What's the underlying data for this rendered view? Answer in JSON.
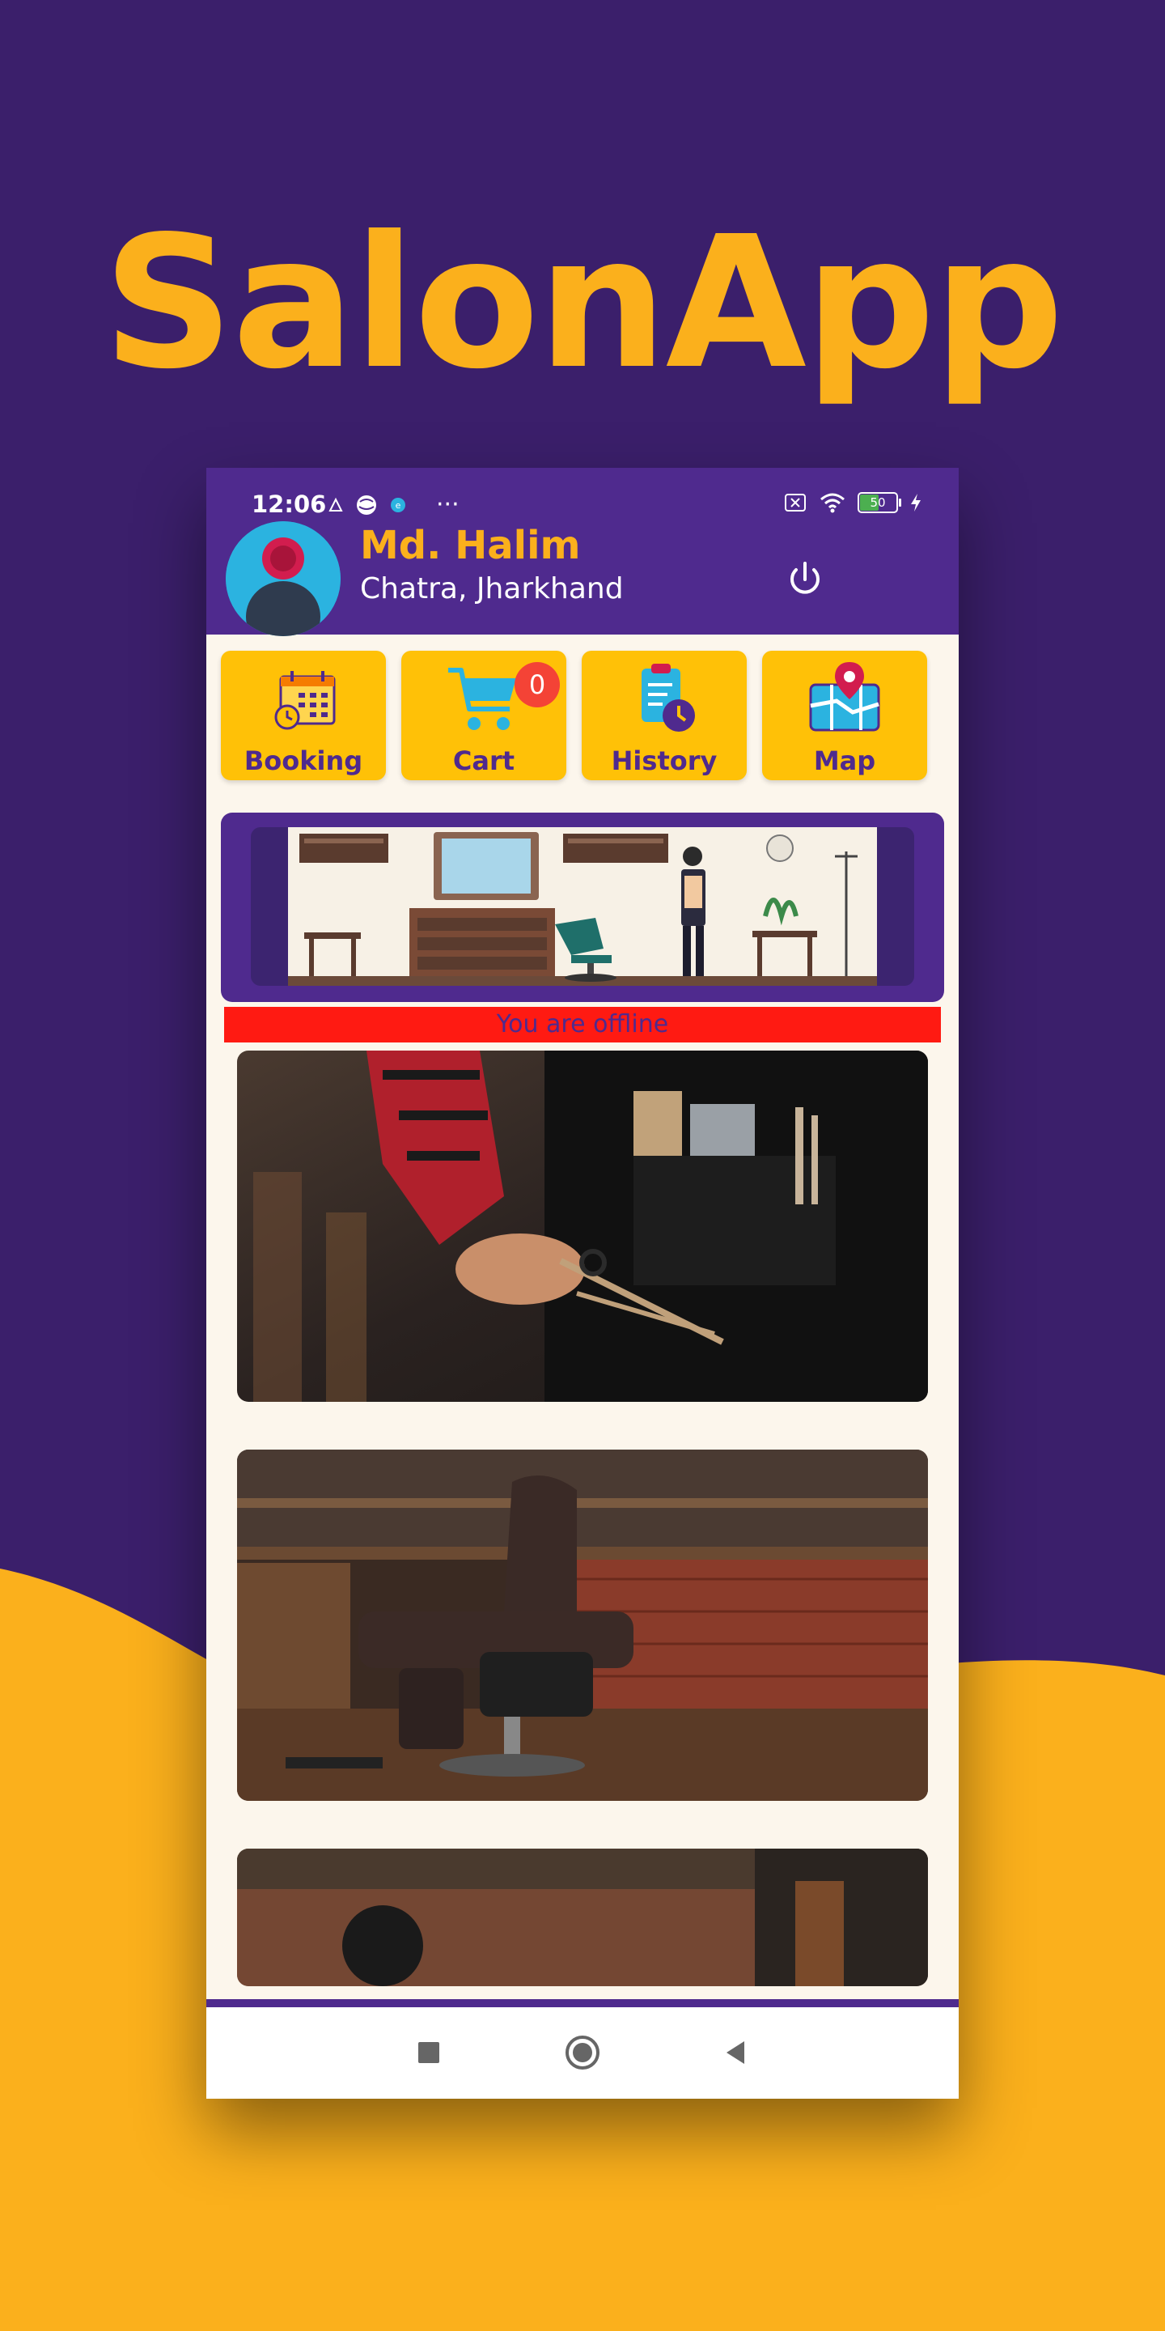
{
  "promo": {
    "title": "SalonApp"
  },
  "status_bar": {
    "time": "12:06",
    "more": "···",
    "battery_level": "50"
  },
  "user": {
    "name": "Md. Halim",
    "location": "Chatra, Jharkhand"
  },
  "menu": [
    {
      "label": "Booking",
      "icon": "calendar-clock-icon"
    },
    {
      "label": "Cart",
      "icon": "shopping-cart-icon",
      "badge": "0"
    },
    {
      "label": "History",
      "icon": "clipboard-clock-icon"
    },
    {
      "label": "Map",
      "icon": "map-pin-icon"
    }
  ],
  "banner": {
    "icon": "barbershop-illustration"
  },
  "status": {
    "offline_message": "You are offline"
  },
  "colors": {
    "background": "#3b1f6b",
    "accent": "#fbb01c",
    "header": "#4f2a8e",
    "tile": "#ffc107",
    "offline": "#ff1a12",
    "badge": "#f44336"
  },
  "navigation": {
    "recents_icon": "square-icon",
    "home_icon": "circle-icon",
    "back_icon": "triangle-back-icon"
  }
}
